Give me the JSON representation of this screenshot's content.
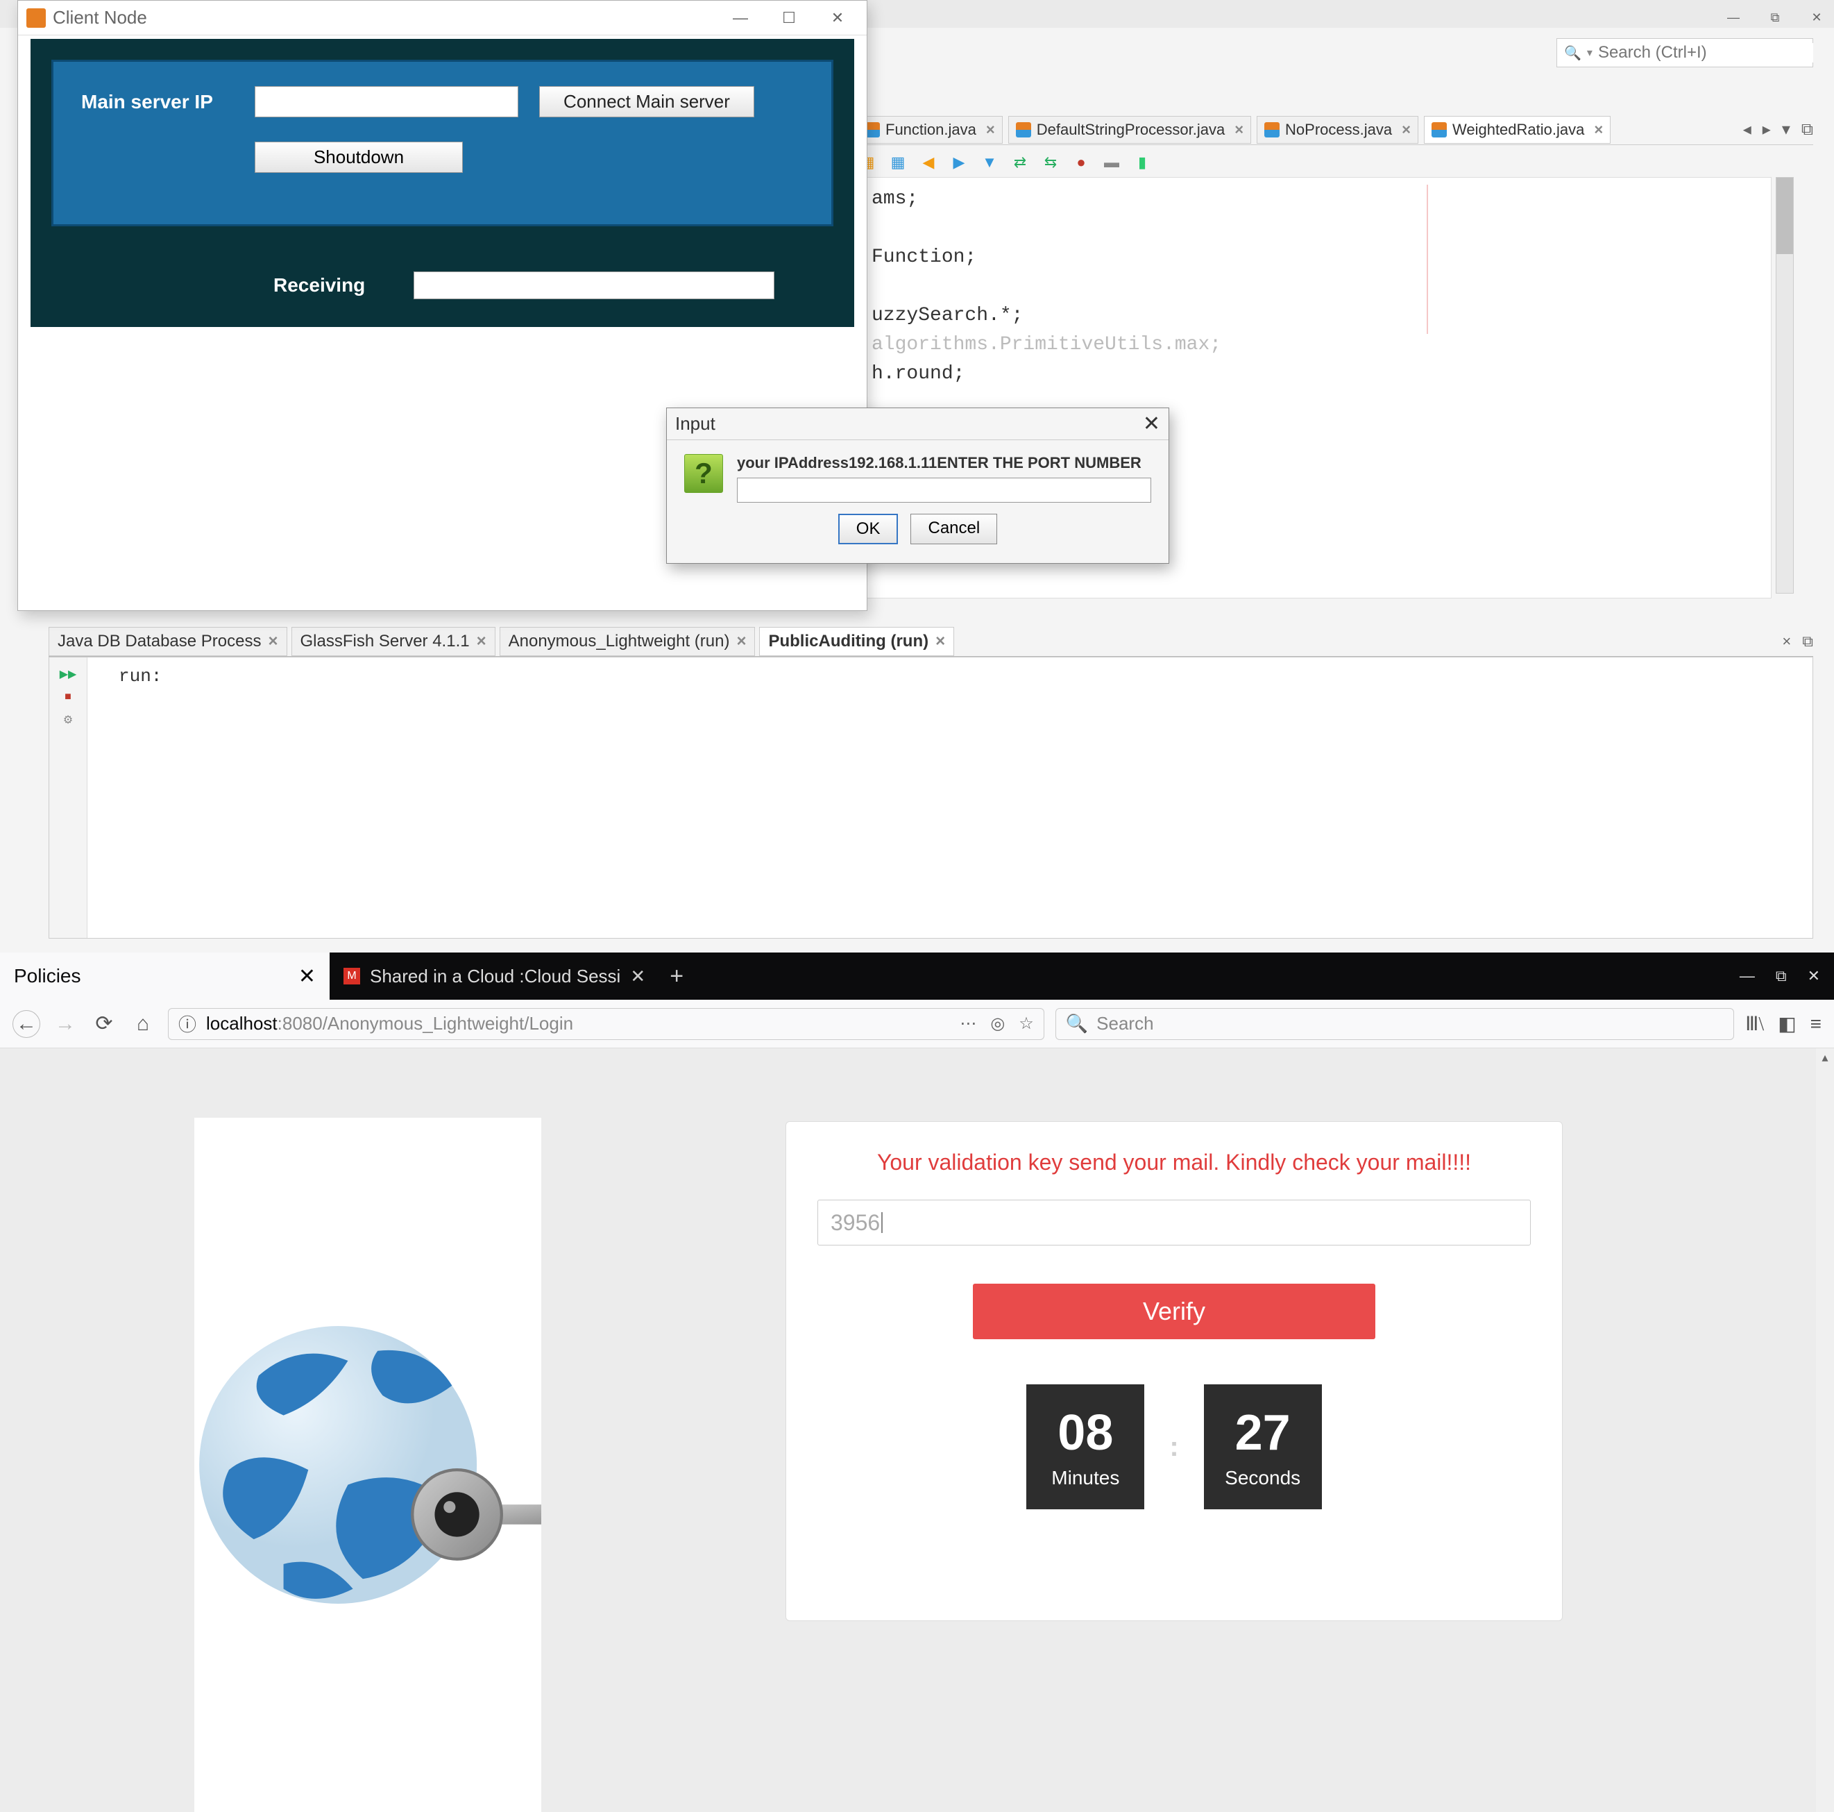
{
  "ide": {
    "search_placeholder": "Search (Ctrl+I)",
    "tabs": [
      {
        "label": "Function.java"
      },
      {
        "label": "DefaultStringProcessor.java"
      },
      {
        "label": "NoProcess.java"
      },
      {
        "label": "WeightedRatio.java"
      }
    ],
    "code_lines": [
      "ams;",
      "",
      "Function;",
      "",
      "uzzySearch.*;",
      "algorithms.PrimitiveUtils.max;",
      "h.round;"
    ],
    "output_tabs": [
      {
        "label": "Java DB Database Process"
      },
      {
        "label": "GlassFish Server 4.1.1"
      },
      {
        "label": "Anonymous_Lightweight (run)"
      },
      {
        "label": "PublicAuditing (run)"
      }
    ],
    "run_text": "run:"
  },
  "client_node": {
    "title": "Client Node",
    "labels": {
      "main_server_ip": "Main server IP",
      "receiving": "Receiving"
    },
    "buttons": {
      "connect": "Connect Main server",
      "shutdown": "Shoutdown"
    }
  },
  "input_dialog": {
    "title": "Input",
    "message": "your IPAddress192.168.1.11ENTER THE PORT NUMBER",
    "ok": "OK",
    "cancel": "Cancel"
  },
  "browser": {
    "tabs": [
      {
        "label": "Policies",
        "light": true
      },
      {
        "label": "Shared in a Cloud :Cloud Sessi"
      }
    ],
    "url_host": "localhost",
    "url_port_path": ":8080/Anonymous_Lightweight/Login",
    "search_placeholder": "Search",
    "page": {
      "notice": "Your validation key send your mail. Kindly check your mail!!!!",
      "code_value": "3956",
      "verify_label": "Verify",
      "minutes": "08",
      "minutes_label": "Minutes",
      "seconds": "27",
      "seconds_label": "Seconds"
    }
  }
}
